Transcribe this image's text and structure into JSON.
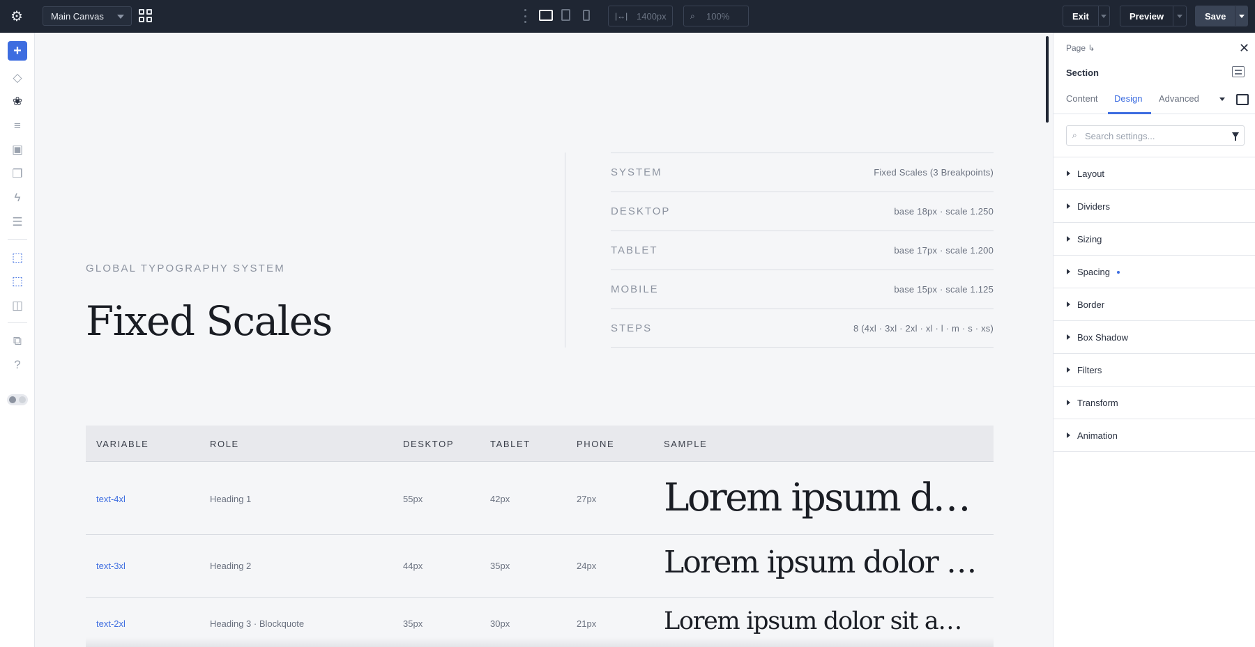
{
  "topbar": {
    "canvas_select": "Main Canvas",
    "width_value": "1400px",
    "zoom_value": "100%",
    "exit_label": "Exit",
    "preview_label": "Preview",
    "save_label": "Save"
  },
  "left_toolbar": {
    "items": [
      "add",
      "layers",
      "styles",
      "data",
      "components",
      "pages",
      "interactions",
      "sections",
      "selector",
      "multi-selector",
      "preview-browser",
      "templates",
      "help",
      "theme-toggle"
    ]
  },
  "canvas": {
    "eyebrow": "GLOBAL TYPOGRAPHY SYSTEM",
    "title": "Fixed Scales",
    "specs": [
      {
        "key": "SYSTEM",
        "value": "Fixed Scales (3 Breakpoints)"
      },
      {
        "key": "DESKTOP",
        "value": "base 18px · scale 1.250"
      },
      {
        "key": "TABLET",
        "value": "base 17px · scale 1.200"
      },
      {
        "key": "MOBILE",
        "value": "base 15px · scale 1.125"
      },
      {
        "key": "STEPS",
        "value": "8 (4xl · 3xl · 2xl · xl · l · m · s · xs)"
      }
    ],
    "table": {
      "headers": [
        "VARIABLE",
        "ROLE",
        "DESKTOP",
        "TABLET",
        "PHONE",
        "SAMPLE"
      ],
      "rows": [
        {
          "variable": "text-4xl",
          "role": "Heading 1",
          "desktop": "55px",
          "tablet": "42px",
          "phone": "27px",
          "sample": "Lorem ipsum dolor sit amet"
        },
        {
          "variable": "text-3xl",
          "role": "Heading 2",
          "desktop": "44px",
          "tablet": "35px",
          "phone": "24px",
          "sample": "Lorem ipsum dolor sit amet"
        },
        {
          "variable": "text-2xl",
          "role": "Heading 3 · Blockquote",
          "desktop": "35px",
          "tablet": "30px",
          "phone": "21px",
          "sample": "Lorem ipsum dolor sit amet, consectetur"
        }
      ]
    }
  },
  "panel": {
    "breadcrumb": "Page ↳",
    "element": "Section",
    "tabs": [
      "Content",
      "Design",
      "Advanced"
    ],
    "active_tab": "Design",
    "search_placeholder": "Search settings...",
    "accordions": [
      {
        "label": "Layout",
        "modified": false
      },
      {
        "label": "Dividers",
        "modified": false
      },
      {
        "label": "Sizing",
        "modified": false
      },
      {
        "label": "Spacing",
        "modified": true
      },
      {
        "label": "Border",
        "modified": false
      },
      {
        "label": "Box Shadow",
        "modified": false
      },
      {
        "label": "Filters",
        "modified": false
      },
      {
        "label": "Transform",
        "modified": false
      },
      {
        "label": "Animation",
        "modified": false
      }
    ]
  },
  "colors": {
    "accent": "#3d6de0",
    "topbar_bg": "#1f2633",
    "canvas_bg": "#f5f6f8"
  }
}
